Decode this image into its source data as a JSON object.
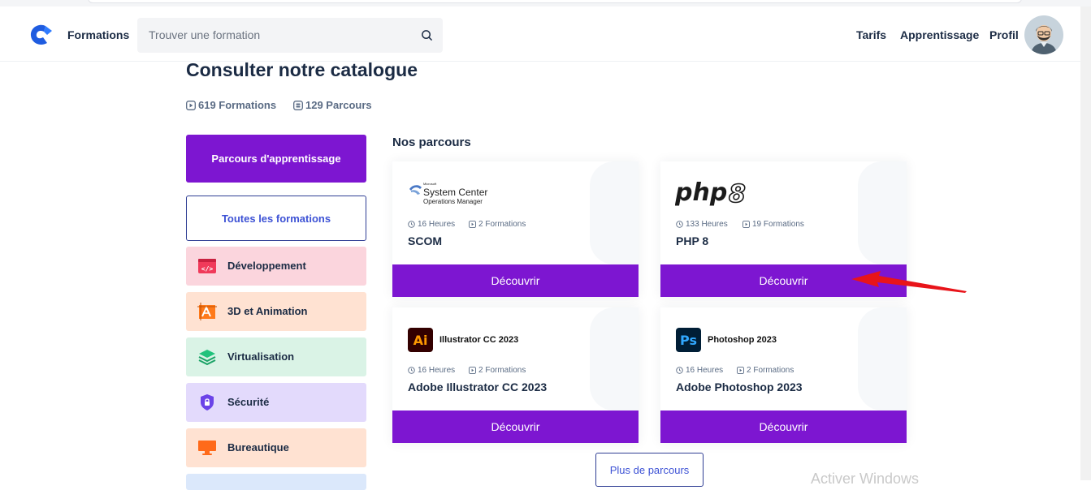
{
  "header": {
    "nav_formations": "Formations",
    "search_placeholder": "Trouver une formation",
    "nav_tarifs": "Tarifs",
    "nav_apprentissage": "Apprentissage",
    "nav_profil": "Profil"
  },
  "page": {
    "title": "Consulter notre catalogue",
    "stat_formations": "619 Formations",
    "stat_parcours": "129 Parcours"
  },
  "sidebar": {
    "primary_label": "Parcours d'apprentissage",
    "outline_label": "Toutes les formations",
    "categories": [
      {
        "label": "Développement",
        "color": "#fbd5dd",
        "icon": "code-window-icon"
      },
      {
        "label": "3D et Animation",
        "color": "#ffe2d2",
        "icon": "artboard-icon"
      },
      {
        "label": "Virtualisation",
        "color": "#daf3e6",
        "icon": "layers-icon"
      },
      {
        "label": "Sécurité",
        "color": "#e3dafc",
        "icon": "shield-lock-icon"
      },
      {
        "label": "Bureautique",
        "color": "#ffe2d2",
        "icon": "monitor-icon"
      }
    ]
  },
  "section": {
    "title": "Nos parcours"
  },
  "cards": [
    {
      "title": "SCOM",
      "hours": "16 Heures",
      "formations": "2 Formations",
      "logo_line1": "Microsoft",
      "logo_line2": "System Center",
      "logo_line3": "Operations Manager",
      "button": "Découvrir"
    },
    {
      "title": "PHP 8",
      "hours": "133 Heures",
      "formations": "19 Formations",
      "logo_text": "php",
      "logo_num": "8",
      "button": "Découvrir"
    },
    {
      "title": "Adobe Illustrator CC 2023",
      "hours": "16 Heures",
      "formations": "2 Formations",
      "logo_badge": "Ai",
      "logo_label": "Illustrator CC 2023",
      "button": "Découvrir"
    },
    {
      "title": "Adobe Photoshop 2023",
      "hours": "16 Heures",
      "formations": "2 Formations",
      "logo_badge": "Ps",
      "logo_label": "Photoshop 2023",
      "button": "Découvrir"
    }
  ],
  "more_button": "Plus de parcours",
  "watermark": "Activer Windows",
  "colors": {
    "accent": "#7d16d1",
    "text": "#1b2b44",
    "link": "#3d52d5",
    "annotation_arrow": "#e8141a"
  }
}
